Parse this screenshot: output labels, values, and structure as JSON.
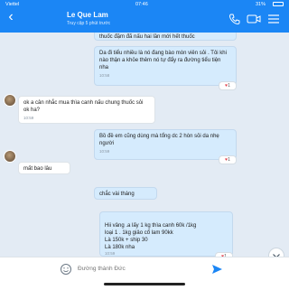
{
  "status_bar": {
    "carrier": "Viettel",
    "time": "07:46",
    "battery": "31%"
  },
  "header": {
    "title": "Le Que Lam",
    "subtitle": "Truy cập 5 phút trước"
  },
  "messages": [
    {
      "side": "out",
      "text": "thuốc đặm đã nấu hai lần mới hết thuốc"
    },
    {
      "side": "out",
      "text": "Da đi tiểu nhiều là nó đang bào mòn viên sỏi . Tôi khi nào thận a khỏe thêm nó tự đẩy ra đường tiểu tiện nha",
      "time": "10:58"
    },
    {
      "side": "in",
      "text": "ok a cân nhắc mua thìa canh nấu chung thuốc sỏi ok ha?",
      "time": "10:59"
    },
    {
      "side": "out",
      "text": "Bồ đề em cũng dùng mà tổng dc 2 hòn sỏi da nhẹ người",
      "time": "10:59"
    },
    {
      "side": "in",
      "text": "mất bao lâu"
    },
    {
      "side": "out",
      "text": "chắc vài tháng"
    },
    {
      "side": "out",
      "text": "Hii vâng .a lấy 1 kg thìa canh 60k /1kg\nloại 1 . 1kg giảo cổ lam 90kk\nLà 150k + ship 30\nLà 180k nha",
      "time": "10:59"
    }
  ],
  "reactions": [
    {
      "icon": "heart",
      "count": "1"
    },
    {
      "icon": "heart",
      "count": "1"
    },
    {
      "icon": "heart",
      "count": "1"
    }
  ],
  "composer": {
    "placeholder": "Đường thành Đức"
  }
}
